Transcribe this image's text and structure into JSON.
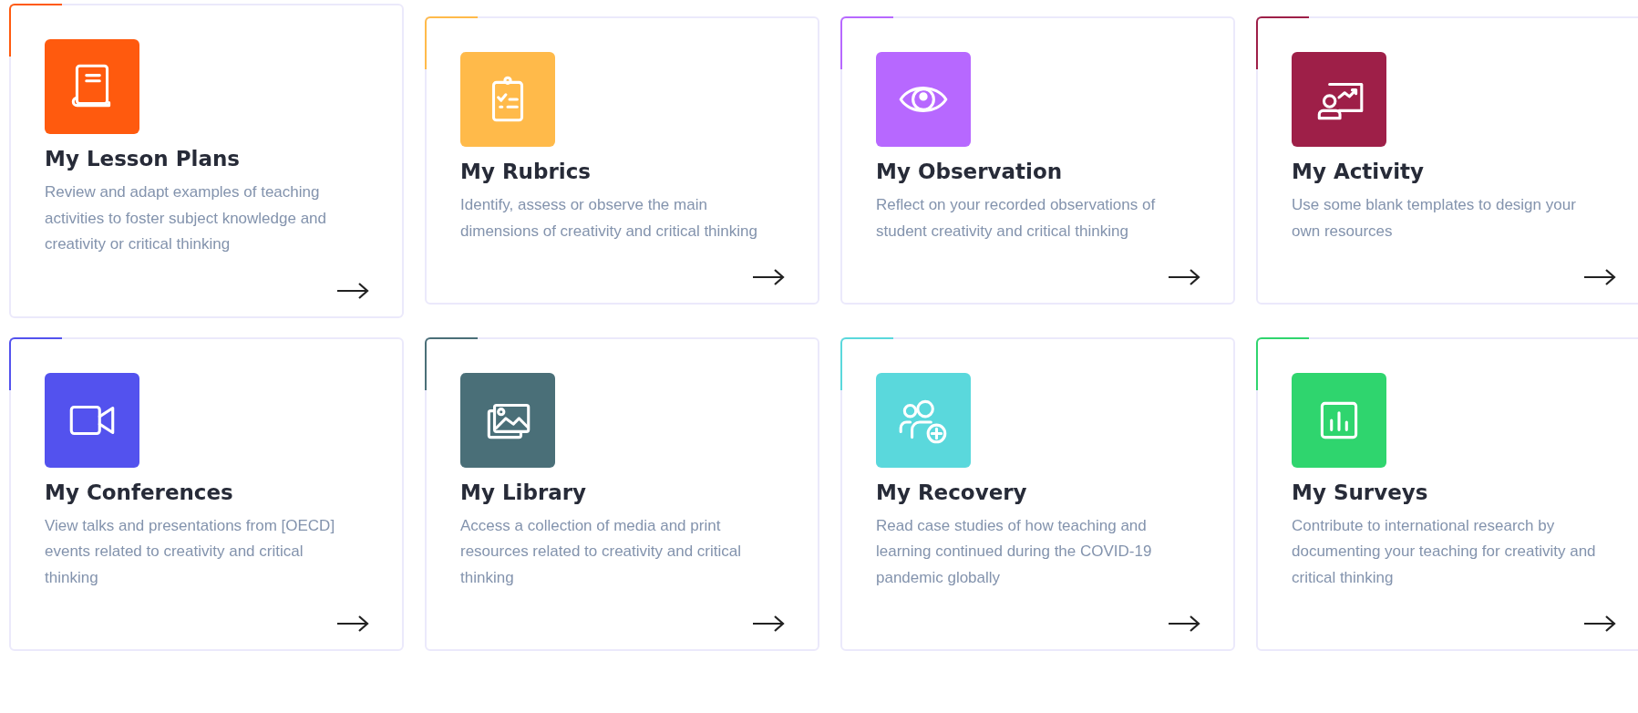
{
  "cards": [
    {
      "title": "My Lesson Plans",
      "description": "Review and adapt examples of teaching activities to foster subject knowledge and creativity or critical thinking",
      "color": "#ff5a0e",
      "kind": "book"
    },
    {
      "title": "My Rubrics",
      "description": "Identify, assess or observe the main dimensions of creativity and critical thinking",
      "color": "#ffba4a",
      "kind": "clipboard"
    },
    {
      "title": "My Observation",
      "description": "Reflect on your recorded observations of student creativity and critical thinking",
      "color": "#b768ff",
      "kind": "eye"
    },
    {
      "title": "My Activity",
      "description": "Use some blank templates to design your own resources",
      "color": "#9e1f48",
      "kind": "presenter"
    },
    {
      "title": "My Conferences",
      "description": "View talks and presentations from [OECD] events related to creativity and critical thinking",
      "color": "#5352ee",
      "kind": "video"
    },
    {
      "title": "My Library",
      "description": "Access a collection of media and print resources related to creativity and critical thinking",
      "color": "#4a6f78",
      "kind": "images"
    },
    {
      "title": "My Recovery",
      "description": "Read case studies of how teaching and learning continued during the COVID-19 pandemic globally",
      "color": "#5ad8dc",
      "kind": "users"
    },
    {
      "title": "My Surveys",
      "description": "Contribute to international research by documenting your teaching for creativity and critical thinking",
      "color": "#2fd56e",
      "kind": "chart"
    }
  ]
}
